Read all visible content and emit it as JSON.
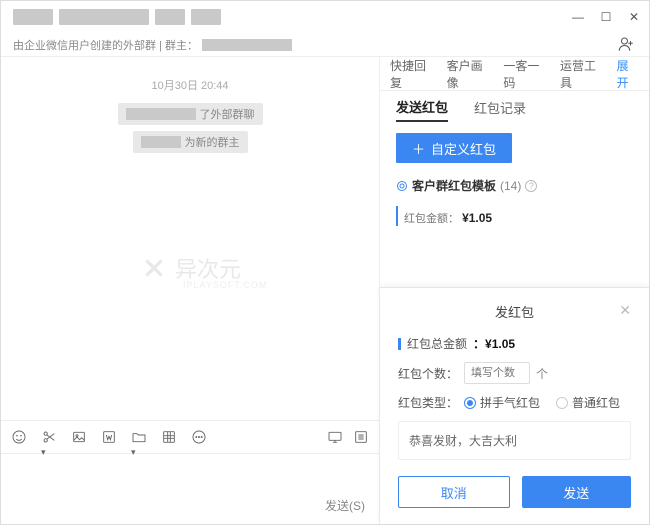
{
  "subtitle": {
    "text": "由企业微信用户创建的外部群 | 群主："
  },
  "chat": {
    "timestamp": "10月30日 20:44",
    "sys1_suffix": "了外部群聊",
    "sys2_suffix": "为新的群主"
  },
  "watermark": {
    "brand": "异次元",
    "sub": "IPLAYSOFT.COM"
  },
  "toolbar_send": "发送(S)",
  "right_tabs": {
    "items": [
      "快捷回复",
      "客户画像",
      "一客一码",
      "运营工具"
    ],
    "expand": "展开"
  },
  "sub_tabs": {
    "send": "发送红包",
    "history": "红包记录"
  },
  "custom_btn": "自定义红包",
  "template_header": {
    "label": "客户群红包模板",
    "count": "(14)"
  },
  "amount_row": {
    "label": "红包金额",
    "value": "¥1.05"
  },
  "modal": {
    "title": "发红包",
    "total_label": "红包总金额",
    "total_value": "：¥1.05",
    "count_label": "红包个数：",
    "count_placeholder": "填写个数",
    "count_suffix": "个",
    "type_label": "红包类型：",
    "type_lucky": "拼手气红包",
    "type_normal": "普通红包",
    "greeting": "恭喜发财，大吉大利",
    "cancel": "取消",
    "send": "发送"
  }
}
